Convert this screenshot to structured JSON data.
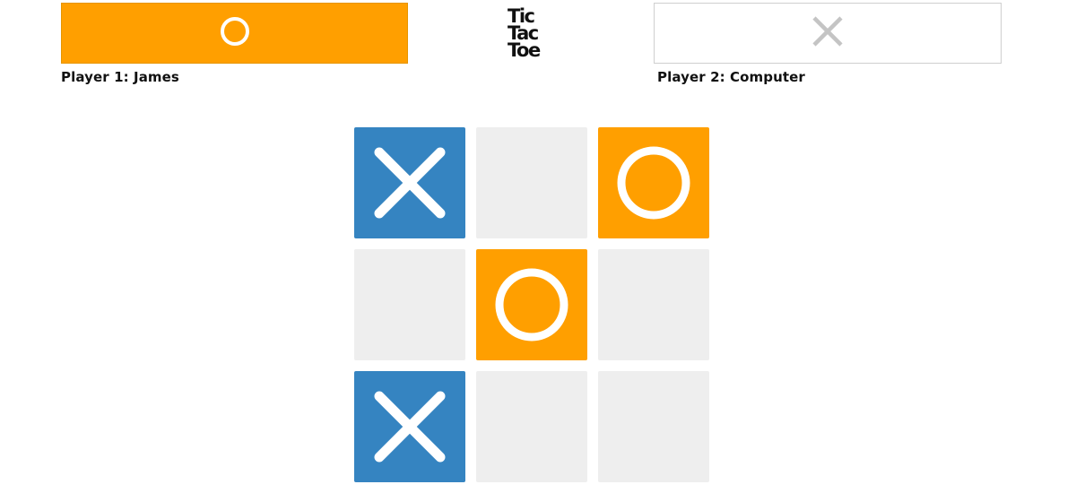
{
  "players": {
    "player1": {
      "label": "Player 1: James",
      "mark": "o-icon"
    },
    "player2": {
      "label": "Player 2: Computer",
      "mark": "x-icon"
    }
  },
  "logo": {
    "lines": [
      "Tic",
      "Tac",
      "Toe"
    ]
  },
  "board": {
    "cells": [
      "X",
      "",
      "O",
      "",
      "O",
      "",
      "X",
      "",
      ""
    ]
  },
  "colors": {
    "o_mark": "#ff9f00",
    "x_mark": "#3584c1",
    "empty_cell": "#eeeeee",
    "player1_bar_active": "#ff9f00",
    "player2_bar_inactive": "#ffffff",
    "inactive_icon": "#c4c4c4"
  }
}
